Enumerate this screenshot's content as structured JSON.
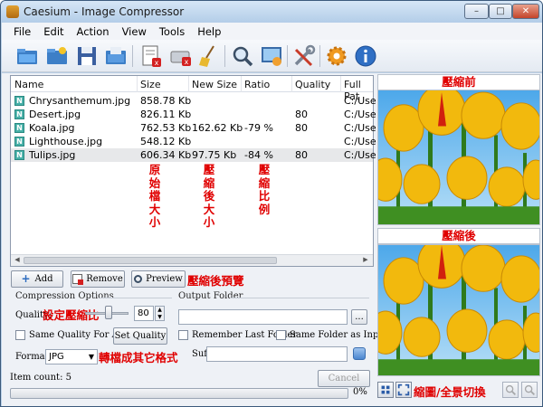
{
  "window": {
    "title": "Caesium - Image Compressor"
  },
  "menu": [
    "File",
    "Edit",
    "Action",
    "View",
    "Tools",
    "Help"
  ],
  "toolbar": {
    "icons": [
      "open-folder-icon",
      "open-file-icon",
      "save-icon",
      "save-folder-icon",
      "clear-list-icon",
      "remove-disk-icon",
      "broom-clean-icon",
      "search-icon",
      "preview-window-icon",
      "tools-icon",
      "settings-gear-icon",
      "info-icon"
    ]
  },
  "list": {
    "columns": [
      "Name",
      "Size",
      "New Size",
      "Ratio",
      "Quality",
      "Full Pat"
    ],
    "rows": [
      {
        "name": "Chrysanthemum.jpg",
        "size": "858.78 Kb",
        "new_size": "",
        "ratio": "",
        "quality": "",
        "path": "C:/Use"
      },
      {
        "name": "Desert.jpg",
        "size": "826.11 Kb",
        "new_size": "",
        "ratio": "",
        "quality": "80",
        "path": "C:/Use"
      },
      {
        "name": "Koala.jpg",
        "size": "762.53 Kb",
        "new_size": "162.62 Kb",
        "ratio": "-79 %",
        "quality": "80",
        "path": "C:/Use"
      },
      {
        "name": "Lighthouse.jpg",
        "size": "548.12 Kb",
        "new_size": "",
        "ratio": "",
        "quality": "",
        "path": "C:/Use"
      },
      {
        "name": "Tulips.jpg",
        "size": "606.34 Kb",
        "new_size": "97.75 Kb",
        "ratio": "-84 %",
        "quality": "80",
        "path": "C:/Use"
      }
    ],
    "file_badge": "N"
  },
  "annotations": {
    "orig_size": "原始檔大小",
    "new_size": "壓縮後大小",
    "ratio": "壓縮比例",
    "preview": "壓縮後預覽",
    "set_ratio": "設定壓縮比",
    "convert": "轉檔成其它格式",
    "toggle": "縮圖/全景切換"
  },
  "buttons": {
    "add": "Add",
    "remove": "Remove",
    "preview": "Preview",
    "set_quality": "Set Quality",
    "cancel": "Cancel",
    "browse": "..."
  },
  "compression": {
    "group_label": "Compression Options",
    "quality_label": "Quality:",
    "quality_value": "80",
    "same_quality_label": "Same Quality For All",
    "format_label": "Format:",
    "format_value": "JPG"
  },
  "output": {
    "group_label": "Output Folder",
    "folder_value": "",
    "remember_label": "Remember Last Folder",
    "same_folder_label": "Same Folder as Input",
    "suffix_label": "Suffix:",
    "suffix_value": ""
  },
  "preview": {
    "before_title": "壓縮前",
    "after_title": "壓縮後"
  },
  "status": {
    "item_count": "Item count: 5",
    "progress_percent": "0%",
    "progress": 0
  },
  "colors": {
    "annotation": "#e00000",
    "tulip": "#f2b90d",
    "sky": "#5fb0ea"
  }
}
